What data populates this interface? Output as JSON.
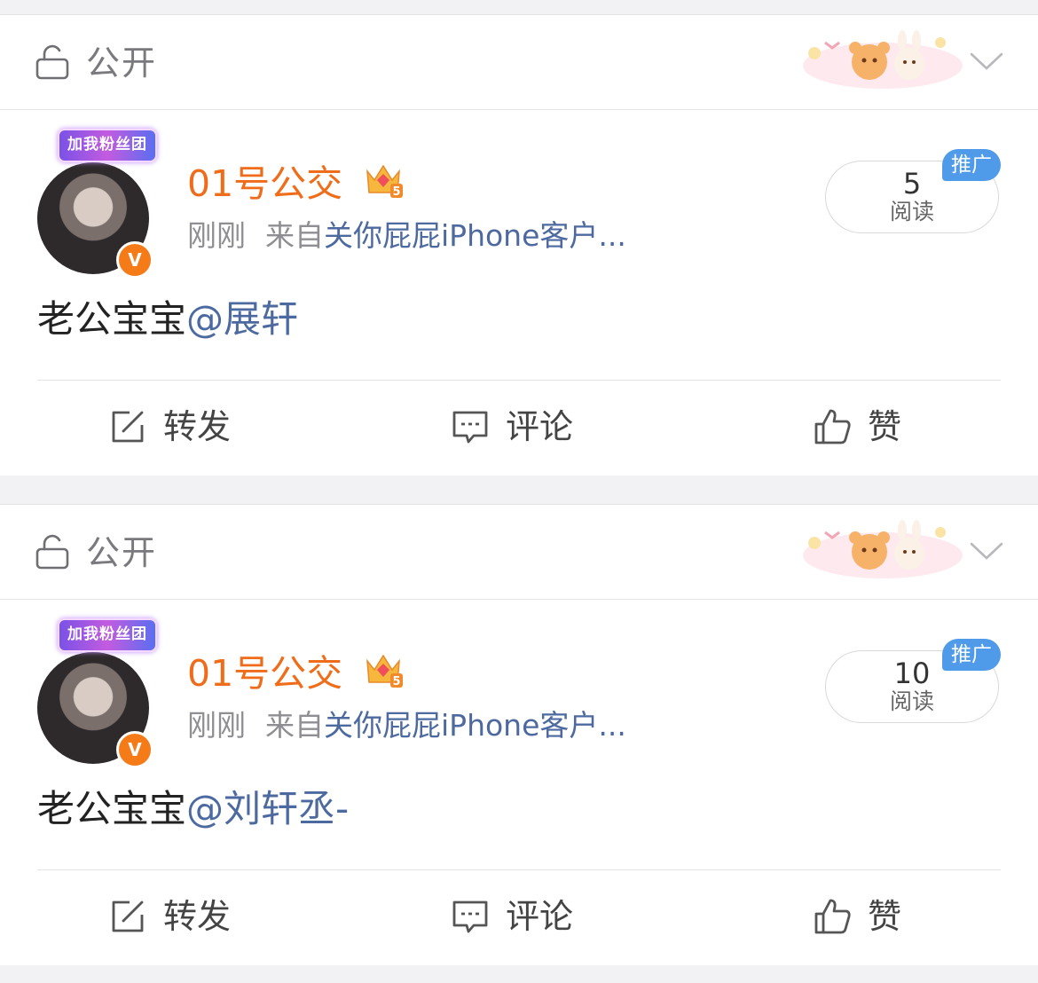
{
  "posts": [
    {
      "visibility": "公开",
      "fan_badge": "加我粉丝团",
      "verified_mark": "V",
      "username": "01号公交",
      "crown_level": "5",
      "time": "刚刚",
      "from_prefix": "来自",
      "client": "关你屁屁iPhone客户...",
      "read_count": "5",
      "read_label": "阅读",
      "promo_tag": "推广",
      "text": "老公宝宝",
      "mention": "@展轩",
      "actions": {
        "repost": "转发",
        "comment": "评论",
        "like": "赞"
      }
    },
    {
      "visibility": "公开",
      "fan_badge": "加我粉丝团",
      "verified_mark": "V",
      "username": "01号公交",
      "crown_level": "5",
      "time": "刚刚",
      "from_prefix": "来自",
      "client": "关你屁屁iPhone客户...",
      "read_count": "10",
      "read_label": "阅读",
      "promo_tag": "推广",
      "text": "老公宝宝",
      "mention": "@刘轩丞-",
      "actions": {
        "repost": "转发",
        "comment": "评论",
        "like": "赞"
      }
    }
  ],
  "icons": {
    "visibility": "lock-open-icon",
    "menu": "chevron-down-icon",
    "decoration": "bear-bunny-sticker",
    "crown": "crown-icon",
    "repost": "edit-share-icon",
    "comment": "comment-bubble-icon",
    "like": "thumbs-up-icon"
  },
  "colors": {
    "username": "#ef6c1a",
    "link": "#4d6aa0",
    "promo": "#4f9bea",
    "verified": "#f57b19"
  }
}
